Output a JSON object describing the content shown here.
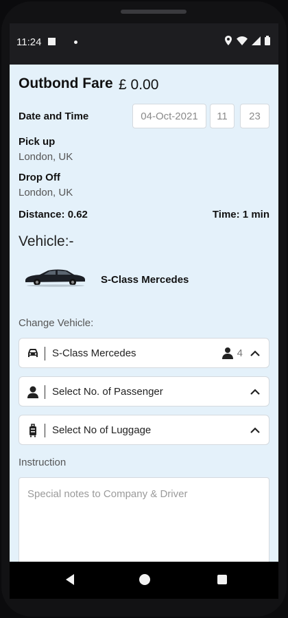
{
  "status_bar": {
    "time": "11:24"
  },
  "fare": {
    "title": "Outbond Fare",
    "amount": "£ 0.00"
  },
  "date_time": {
    "label": "Date and Time",
    "date": "04-Oct-2021",
    "hour": "11",
    "minute": "23"
  },
  "pickup": {
    "label": "Pick up",
    "value": "London, UK"
  },
  "dropoff": {
    "label": "Drop Off",
    "value": "London, UK"
  },
  "trip": {
    "distance": "Distance: 0.62",
    "time": "Time: 1 min"
  },
  "vehicle": {
    "heading": "Vehicle:-",
    "name": "S-Class Mercedes"
  },
  "change_vehicle": {
    "label": "Change Vehicle:",
    "vehicle_select": {
      "value": "S-Class Mercedes",
      "capacity": "4"
    },
    "passenger_select": {
      "value": "Select No. of Passenger"
    },
    "luggage_select": {
      "value": "Select No of Luggage"
    }
  },
  "instruction": {
    "label": "Instruction",
    "placeholder": "Special notes to Company & Driver"
  },
  "colors": {
    "screen_bg": "#e4f1fa",
    "frame": "#121214",
    "status_bar": "#1d1d20"
  }
}
